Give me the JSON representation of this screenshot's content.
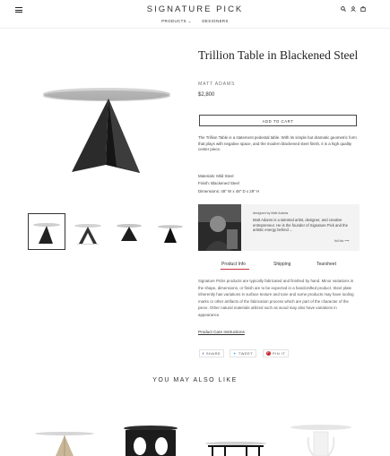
{
  "header": {
    "brand": "SIGNATURE PICK",
    "nav": [
      {
        "label": "PRODUCTS ⌄"
      },
      {
        "label": "DESIGNERS"
      }
    ],
    "icons": {
      "search": "🔍",
      "account": "👤",
      "cart": "🛍"
    }
  },
  "product": {
    "title": "Trillion Table in Blackened Steel",
    "vendor": "MATT ADAMS",
    "price": "$2,800",
    "add_to_cart": "ADD TO CART",
    "description": "The Trillion Table is a statement pedestal table. With its simple but dramatic geometric form that plays with negative space, and the modern blackened steel finish, it is a high quality center piece.",
    "specs": [
      "Materials: Mild Steel",
      "Finish: Blackened Steel",
      "Dimensions: 48\" W x 48\" D x 29\" H"
    ]
  },
  "designer": {
    "designed_by": "designed by Matt Adams",
    "bio": "Matt Adams is a talented artist, designer, and creative entrepreneur. He is the founder of Signature Pick and the artistic energy behind ...",
    "link": "full bio ⟶"
  },
  "tabs": [
    {
      "label": "Product Info"
    },
    {
      "label": "Shipping"
    },
    {
      "label": "Tearsheet"
    }
  ],
  "tab_content": "Signature Picks products are typically fabricated and finished by hand. Minor variations in the shape, dimensions, or finish are to be expected in a handcrafted product. Steel plate inherently has variations in surface texture and tone and some products may have tooling marks or other artifacts of the fabrication process which are part of the character of the piece. Other natural materials utilized such as wood may also have variations in appearance.",
  "care_link": "Product Care Instructions",
  "share": [
    {
      "label": "SHARE",
      "icon": "f"
    },
    {
      "label": "TWEET",
      "icon": "🐦"
    },
    {
      "label": "PIN IT",
      "icon": "P"
    }
  ],
  "related_heading": "YOU MAY ALSO LIKE"
}
